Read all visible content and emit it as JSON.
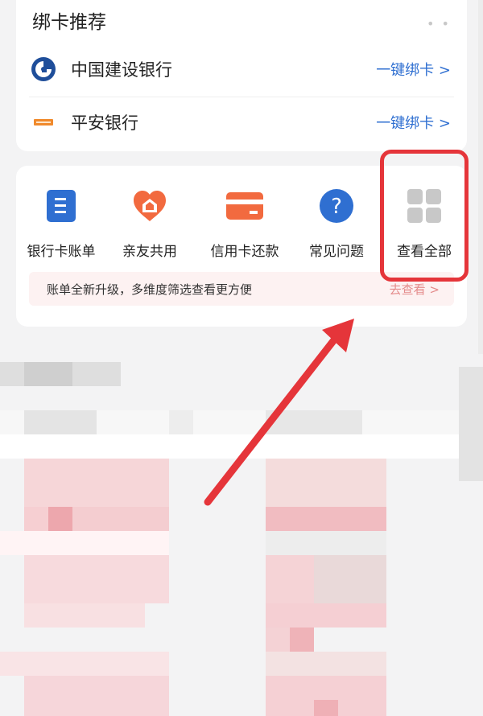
{
  "bind_section": {
    "title": "绑卡推荐",
    "more": "• •",
    "banks": [
      {
        "name": "中国建设银行",
        "action": "一键绑卡 >"
      },
      {
        "name": "平安银行",
        "action": "一键绑卡 >"
      }
    ]
  },
  "services": {
    "items": [
      {
        "label": "银行卡账单",
        "icon": "bill-icon"
      },
      {
        "label": "亲友共用",
        "icon": "family-share-icon"
      },
      {
        "label": "信用卡还款",
        "icon": "credit-card-icon"
      },
      {
        "label": "常见问题",
        "icon": "question-icon"
      },
      {
        "label": "查看全部",
        "icon": "grid-icon"
      }
    ],
    "notice": {
      "text": "账单全新升级，多维度筛选查看更方便",
      "link": "去查看 >"
    }
  },
  "colors": {
    "accent_blue": "#2f6fd1",
    "accent_orange": "#f26a3f",
    "highlight_red": "#e5353a"
  }
}
